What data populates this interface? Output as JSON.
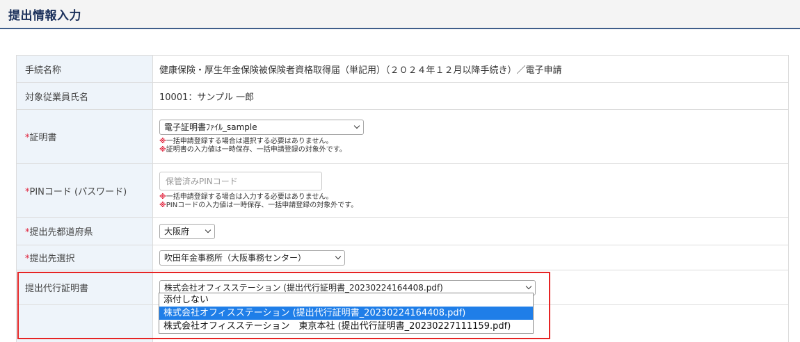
{
  "header": {
    "title": "提出情報入力"
  },
  "rows": {
    "procedure": {
      "label": "手続名称",
      "value": "健康保険・厚生年金保険被保険者資格取得届（単記用）（２０２４年１２月以降手続き）／電子申請"
    },
    "employee": {
      "label": "対象従業員氏名",
      "value": "10001：サンプル 一郎"
    },
    "certificate": {
      "required_mark": "*",
      "label": "証明書",
      "selected": "電子証明書ﾌｧｲﾙ_sample",
      "note_mark": "※",
      "note1": "一括申請登録する場合は選択する必要はありません。",
      "note2": "証明書の入力値は一時保存、一括申請登録の対象外です。"
    },
    "pin": {
      "required_mark": "*",
      "label": "PINコード (パスワード)",
      "placeholder": "保管済みPINコード",
      "note_mark": "※",
      "note1": "一括申請登録する場合は入力する必要はありません。",
      "note2": "PINコードの入力値は一時保存、一括申請登録の対象外です。"
    },
    "prefecture": {
      "required_mark": "*",
      "label": "提出先都道府県",
      "selected": "大阪府"
    },
    "office": {
      "required_mark": "*",
      "label": "提出先選択",
      "selected": "吹田年金事務所（大阪事務センター）"
    },
    "proxy": {
      "label": "提出代行証明書",
      "selected": "株式会社オフィスステーション (提出代行証明書_20230224164408.pdf)"
    }
  },
  "dropdown": {
    "options": [
      {
        "label": "添付しない"
      },
      {
        "label": "株式会社オフィスステーション (提出代行証明書_20230224164408.pdf)"
      },
      {
        "label": "株式会社オフィスステーション　東京本社 (提出代行証明書_20230227111159.pdf)"
      }
    ],
    "selected_index": 1
  },
  "colors": {
    "header_border": "#3f5d8a",
    "label_bg": "#eef4fa",
    "required": "#e0203a",
    "highlight": "#e62424",
    "option_selected": "#1f7ee8"
  },
  "icons": [
    "chevron-down-icon"
  ]
}
